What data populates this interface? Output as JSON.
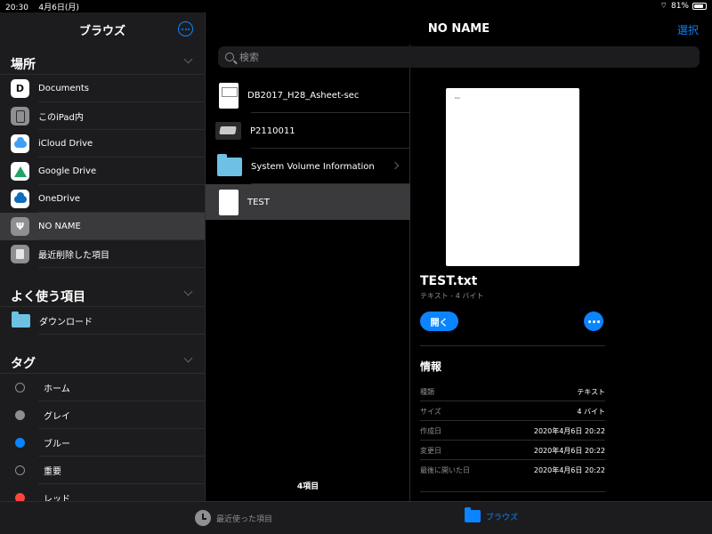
{
  "status": {
    "time": "20:30",
    "date": "4月6日(月)",
    "battery": "81%",
    "battery_level": 0.81
  },
  "sidebar": {
    "title": "ブラウズ",
    "locations_header": "場所",
    "locations": [
      {
        "label": "Documents",
        "icon": "documents-app-icon"
      },
      {
        "label": "このiPad内",
        "icon": "ipad-icon"
      },
      {
        "label": "iCloud Drive",
        "icon": "icloud-icon"
      },
      {
        "label": "Google Drive",
        "icon": "google-drive-icon"
      },
      {
        "label": "OneDrive",
        "icon": "onedrive-icon"
      },
      {
        "label": "NO NAME",
        "icon": "usb-icon"
      },
      {
        "label": "最近削除した項目",
        "icon": "trash-icon"
      }
    ],
    "favorites_header": "よく使う項目",
    "favorites": [
      {
        "label": "ダウンロード",
        "icon": "downloads-folder-icon"
      }
    ],
    "tags_header": "タグ",
    "tags": [
      {
        "label": "ホーム",
        "color": ""
      },
      {
        "label": "グレイ",
        "color": "#8e8e93"
      },
      {
        "label": "ブルー",
        "color": "#0a84ff"
      },
      {
        "label": "重要",
        "color": ""
      },
      {
        "label": "レッド",
        "color": "#ff453a"
      }
    ]
  },
  "nav": {
    "title": "NO NAME",
    "select_label": "選択"
  },
  "search": {
    "placeholder": "検索"
  },
  "files": [
    {
      "name": "DB2017_H28_Asheet-sec",
      "kind": "sheet"
    },
    {
      "name": "P2110011",
      "kind": "photo"
    },
    {
      "name": "System Volume Information",
      "kind": "folder"
    },
    {
      "name": "TEST",
      "kind": "doc"
    }
  ],
  "file_count": "4項目",
  "detail": {
    "preview_text": "test",
    "name": "TEST.txt",
    "subtitle": "テキスト - 4 バイト",
    "open_label": "開く",
    "info_header": "情報",
    "info": [
      {
        "key": "種類",
        "value": "テキスト"
      },
      {
        "key": "サイズ",
        "value": "4 バイト"
      },
      {
        "key": "作成日",
        "value": "2020年4月6日 20:22"
      },
      {
        "key": "変更日",
        "value": "2020年4月6日 20:22"
      },
      {
        "key": "最後に開いた日",
        "value": "2020年4月6日 20:22"
      }
    ]
  },
  "tabbar": {
    "recent_label": "最近使った項目",
    "browse_label": "ブラウズ"
  }
}
